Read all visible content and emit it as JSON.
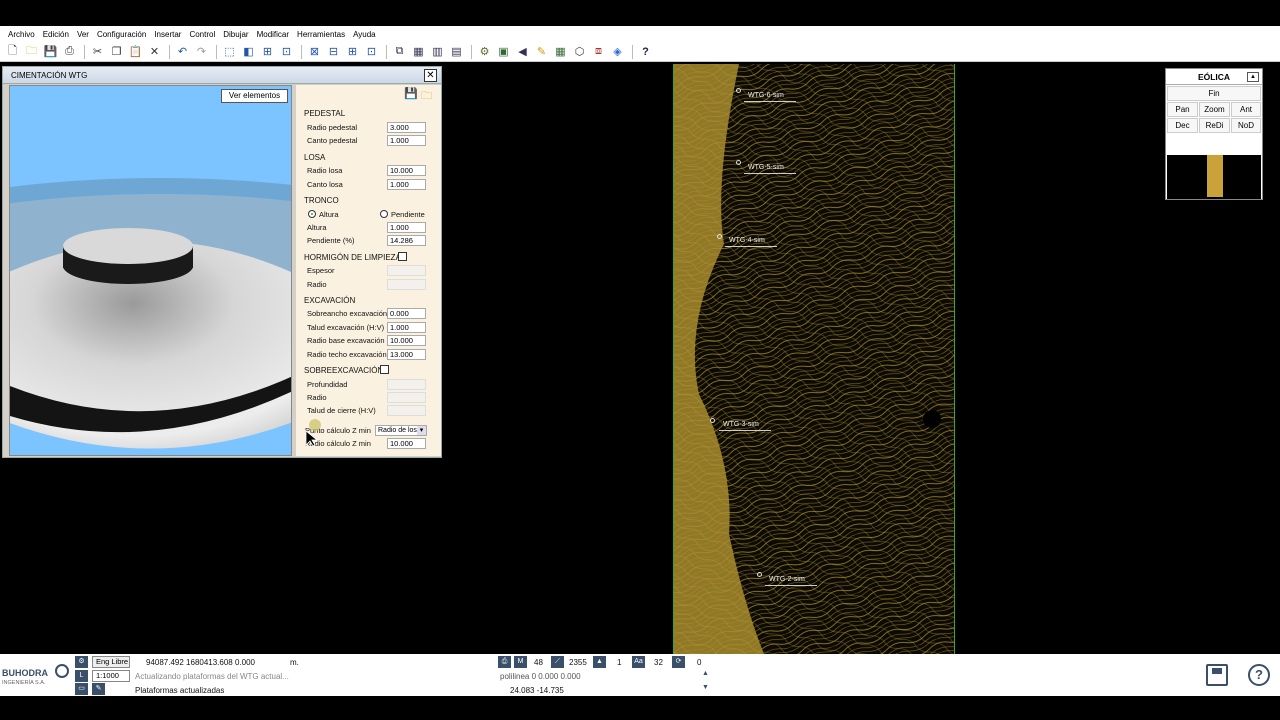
{
  "menu": [
    "Archivo",
    "Edición",
    "Ver",
    "Configuración",
    "Insertar",
    "Control",
    "Dibujar",
    "Modificar",
    "Herramientas",
    "Ayuda"
  ],
  "dialog": {
    "title": "CIMENTACIÓN WTG",
    "close": "✕",
    "ver_elementos": "Ver elementos",
    "sections": {
      "pedestal": "PEDESTAL",
      "losa": "LOSA",
      "tronco": "TRONCO",
      "hormigon": "HORMIGÓN DE LIMPIEZA",
      "excavacion": "EXCAVACIÓN",
      "sobreexcavacion": "SOBREEXCAVACIÓN"
    },
    "fields": {
      "radio_pedestal": {
        "label": "Radio pedestal",
        "value": "3.000"
      },
      "canto_pedestal": {
        "label": "Canto pedestal",
        "value": "1.000"
      },
      "radio_losa": {
        "label": "Radio losa",
        "value": "10.000"
      },
      "canto_losa": {
        "label": "Canto losa",
        "value": "1.000"
      },
      "altura_radio": "Altura",
      "pendiente_radio": "Pendiente",
      "altura": {
        "label": "Altura",
        "value": "1.000"
      },
      "pendiente": {
        "label": "Pendiente (%)",
        "value": "14.286"
      },
      "espesor": {
        "label": "Espesor",
        "value": ""
      },
      "radio_hl": {
        "label": "Radio",
        "value": ""
      },
      "sobreancho": {
        "label": "Sobreancho excavación",
        "value": "0.000"
      },
      "talud": {
        "label": "Talud excavación (H:V)",
        "value": "1.000"
      },
      "radio_base": {
        "label": "Radio base excavación",
        "value": "10.000"
      },
      "radio_techo": {
        "label": "Radio techo excavación",
        "value": "13.000"
      },
      "profundidad": {
        "label": "Profundidad",
        "value": ""
      },
      "radio_se": {
        "label": "Radio",
        "value": ""
      },
      "talud_cierre": {
        "label": "Talud de cierre (H:V)",
        "value": ""
      },
      "punto_calc": {
        "label": "Punto cálculo Z min",
        "value": "Radio de losa"
      },
      "radio_calc": {
        "label": "Radio cálculo Z min",
        "value": "10.000"
      }
    }
  },
  "map": {
    "turbines": [
      {
        "label": "WTG-6-sim"
      },
      {
        "label": "WTG-5-sim"
      },
      {
        "label": "WTG-4-sim"
      },
      {
        "label": "WTG-3-sim"
      },
      {
        "label": "WTG-2-sim"
      }
    ]
  },
  "eolica": {
    "title": "EÓLICA",
    "buttons": {
      "fin": "Fin",
      "pan": "Pan",
      "zoom": "Zoom",
      "ant": "Ant",
      "dec": "Dec",
      "redi": "ReDi",
      "nod": "NoD"
    }
  },
  "status": {
    "logo_name": "BUHODRA",
    "logo_sub": "INGENIERÍA S.A.",
    "eng_libre": "Eng Libre",
    "scale": "1:1000",
    "coords": "94087.492  1680413.608   0.000",
    "units": "m.",
    "message1": "Actualizando plataformas del WTG actual...",
    "message2": "Plataformas actualizadas",
    "num1": "48",
    "num2": "2355",
    "num3": "1",
    "num4": "32",
    "num5": "0",
    "polyline": "polilinea 0 0.000 0.000",
    "xy": "24.083     -14.735"
  },
  "colors": {
    "accent": "#3a4f6a",
    "contour": "#b8962d",
    "sky": "#7cc4ff"
  }
}
